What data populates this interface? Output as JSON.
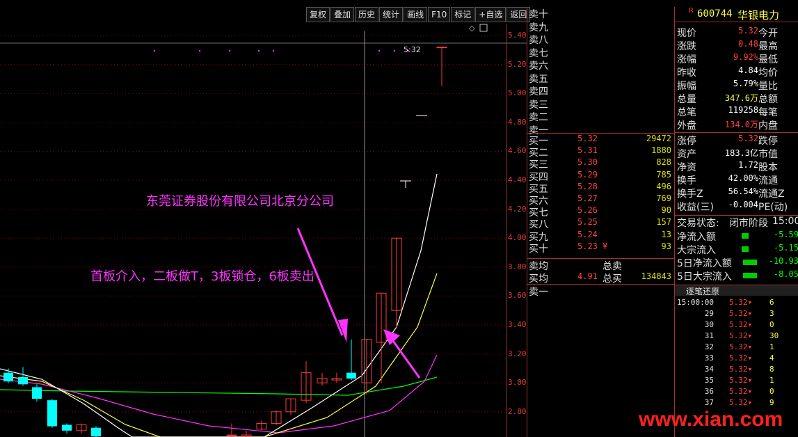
{
  "toolbar": {
    "buttons": [
      "复权",
      "叠加",
      "历史",
      "统计",
      "画线",
      "F10",
      "标记",
      "+自选",
      "返回"
    ]
  },
  "chart": {
    "y_ticks": [
      "5.40",
      "5.20",
      "5.00",
      "4.80",
      "4.60",
      "4.40",
      "4.20",
      "4.00",
      "3.80",
      "3.60",
      "3.40",
      "3.20",
      "3.00",
      "2.80"
    ],
    "cursor_label": "5:32",
    "colors": {
      "up": "#ff3b3b",
      "down": "#00ffff",
      "ma1": "#ffffff",
      "ma2": "#ffff40",
      "ma3": "#ff33ff",
      "ma4": "#00ff00",
      "grid": "#8b0000"
    }
  },
  "annotations": {
    "broker": "东莞证券股份有限公司北京分公司",
    "strategy": "首板介入，二板做T，3板锁仓，6板卖出"
  },
  "stock": {
    "code_prefix": "R",
    "code": "600744",
    "name": "华银电力"
  },
  "order_book": {
    "sells": [
      "卖十",
      "卖九",
      "卖八",
      "卖七",
      "卖六",
      "卖五",
      "卖四",
      "卖三",
      "卖二",
      "卖一"
    ],
    "buys": [
      {
        "label": "买一",
        "price": "5.32",
        "vol": "29472"
      },
      {
        "label": "买二",
        "price": "5.31",
        "vol": "1880"
      },
      {
        "label": "买三",
        "price": "5.30",
        "vol": "828"
      },
      {
        "label": "买四",
        "price": "5.29",
        "vol": "785"
      },
      {
        "label": "买五",
        "price": "5.28",
        "vol": "496"
      },
      {
        "label": "买六",
        "price": "5.27",
        "vol": "769"
      },
      {
        "label": "买七",
        "price": "5.26",
        "vol": "90"
      },
      {
        "label": "买八",
        "price": "5.25",
        "vol": "157"
      },
      {
        "label": "买九",
        "price": "5.24",
        "vol": "13"
      },
      {
        "label": "买十",
        "price": "5.23",
        "vol": "93",
        "mark": "¥"
      }
    ],
    "sell_avg_label": "卖均",
    "total_sell_label": "总卖",
    "buy_avg_label": "买均",
    "buy_avg": "4.91",
    "total_buy_label": "总买",
    "total_buy": "134843",
    "sell_one_label": "卖一"
  },
  "quote": {
    "rows": [
      {
        "k1": "现价",
        "v1": "5.32",
        "c": "#ff4040",
        "k2": "今开"
      },
      {
        "k1": "涨跌",
        "v1": "0.48",
        "c": "#ff4040",
        "k2": "最高"
      },
      {
        "k1": "涨幅",
        "v1": "9.92%",
        "c": "#ff4040",
        "k2": "最低"
      },
      {
        "k1": "昨收",
        "v1": "4.84",
        "c": "#ffffff",
        "k2": "均价"
      },
      {
        "k1": "振幅",
        "v1": "5.79%",
        "c": "#ffffff",
        "k2": "量比"
      },
      {
        "k1": "总量",
        "v1": "347.6万",
        "c": "#ffff40",
        "k2": "总额"
      },
      {
        "k1": "总笔",
        "v1": "119258",
        "c": "#ffffff",
        "k2": "每笔"
      },
      {
        "k1": "外盘",
        "v1": "134.0万",
        "c": "#ff4040",
        "k2": "内盘"
      },
      {
        "k1": "涨停",
        "v1": "5.32",
        "c": "#ff4040",
        "k2": "跌停"
      },
      {
        "k1": "资产",
        "v1": "183.3亿",
        "c": "#ffffff",
        "k2": "市值"
      },
      {
        "k1": "净资",
        "v1": "1.72",
        "c": "#ffffff",
        "k2": "股本"
      },
      {
        "k1": "换手",
        "v1": "42.00%",
        "c": "#ffffff",
        "k2": "流通"
      },
      {
        "k1": "换手Z",
        "v1": "56.54%",
        "c": "#ffffff",
        "k2": "流通Z"
      },
      {
        "k1": "收益(三)",
        "v1": "-0.004",
        "c": "#ffffff",
        "k2": "PE(动)"
      }
    ],
    "trade_status_label": "交易状态:",
    "trade_status": "闭市阶段",
    "trade_time": "15:00",
    "flows": [
      {
        "label": "净流入额",
        "value": "-5.59"
      },
      {
        "label": "大宗流入",
        "value": "-5.15"
      },
      {
        "label": "5日净流入额",
        "value": "-10.93"
      },
      {
        "label": "5日大宗流入",
        "value": "-8.05"
      }
    ],
    "tick_title": "逐笔还原",
    "ticks": [
      {
        "t": "15:00:00",
        "p": "5.32",
        "v": "6"
      },
      {
        "t": "29",
        "p": "5.32",
        "v": "3"
      },
      {
        "t": "30",
        "p": "5.32",
        "v": "0"
      },
      {
        "t": "31",
        "p": "5.32",
        "v": "30"
      },
      {
        "t": "32",
        "p": "5.32",
        "v": "1"
      },
      {
        "t": "33",
        "p": "5.32",
        "v": "4"
      },
      {
        "t": "34",
        "p": "5.32",
        "v": "8"
      },
      {
        "t": "35",
        "p": "5.32",
        "v": "1"
      },
      {
        "t": "36",
        "p": "5.32",
        "v": "0"
      },
      {
        "t": "37",
        "p": "5.32",
        "v": "9"
      }
    ]
  },
  "watermark": "www.xian.com"
}
